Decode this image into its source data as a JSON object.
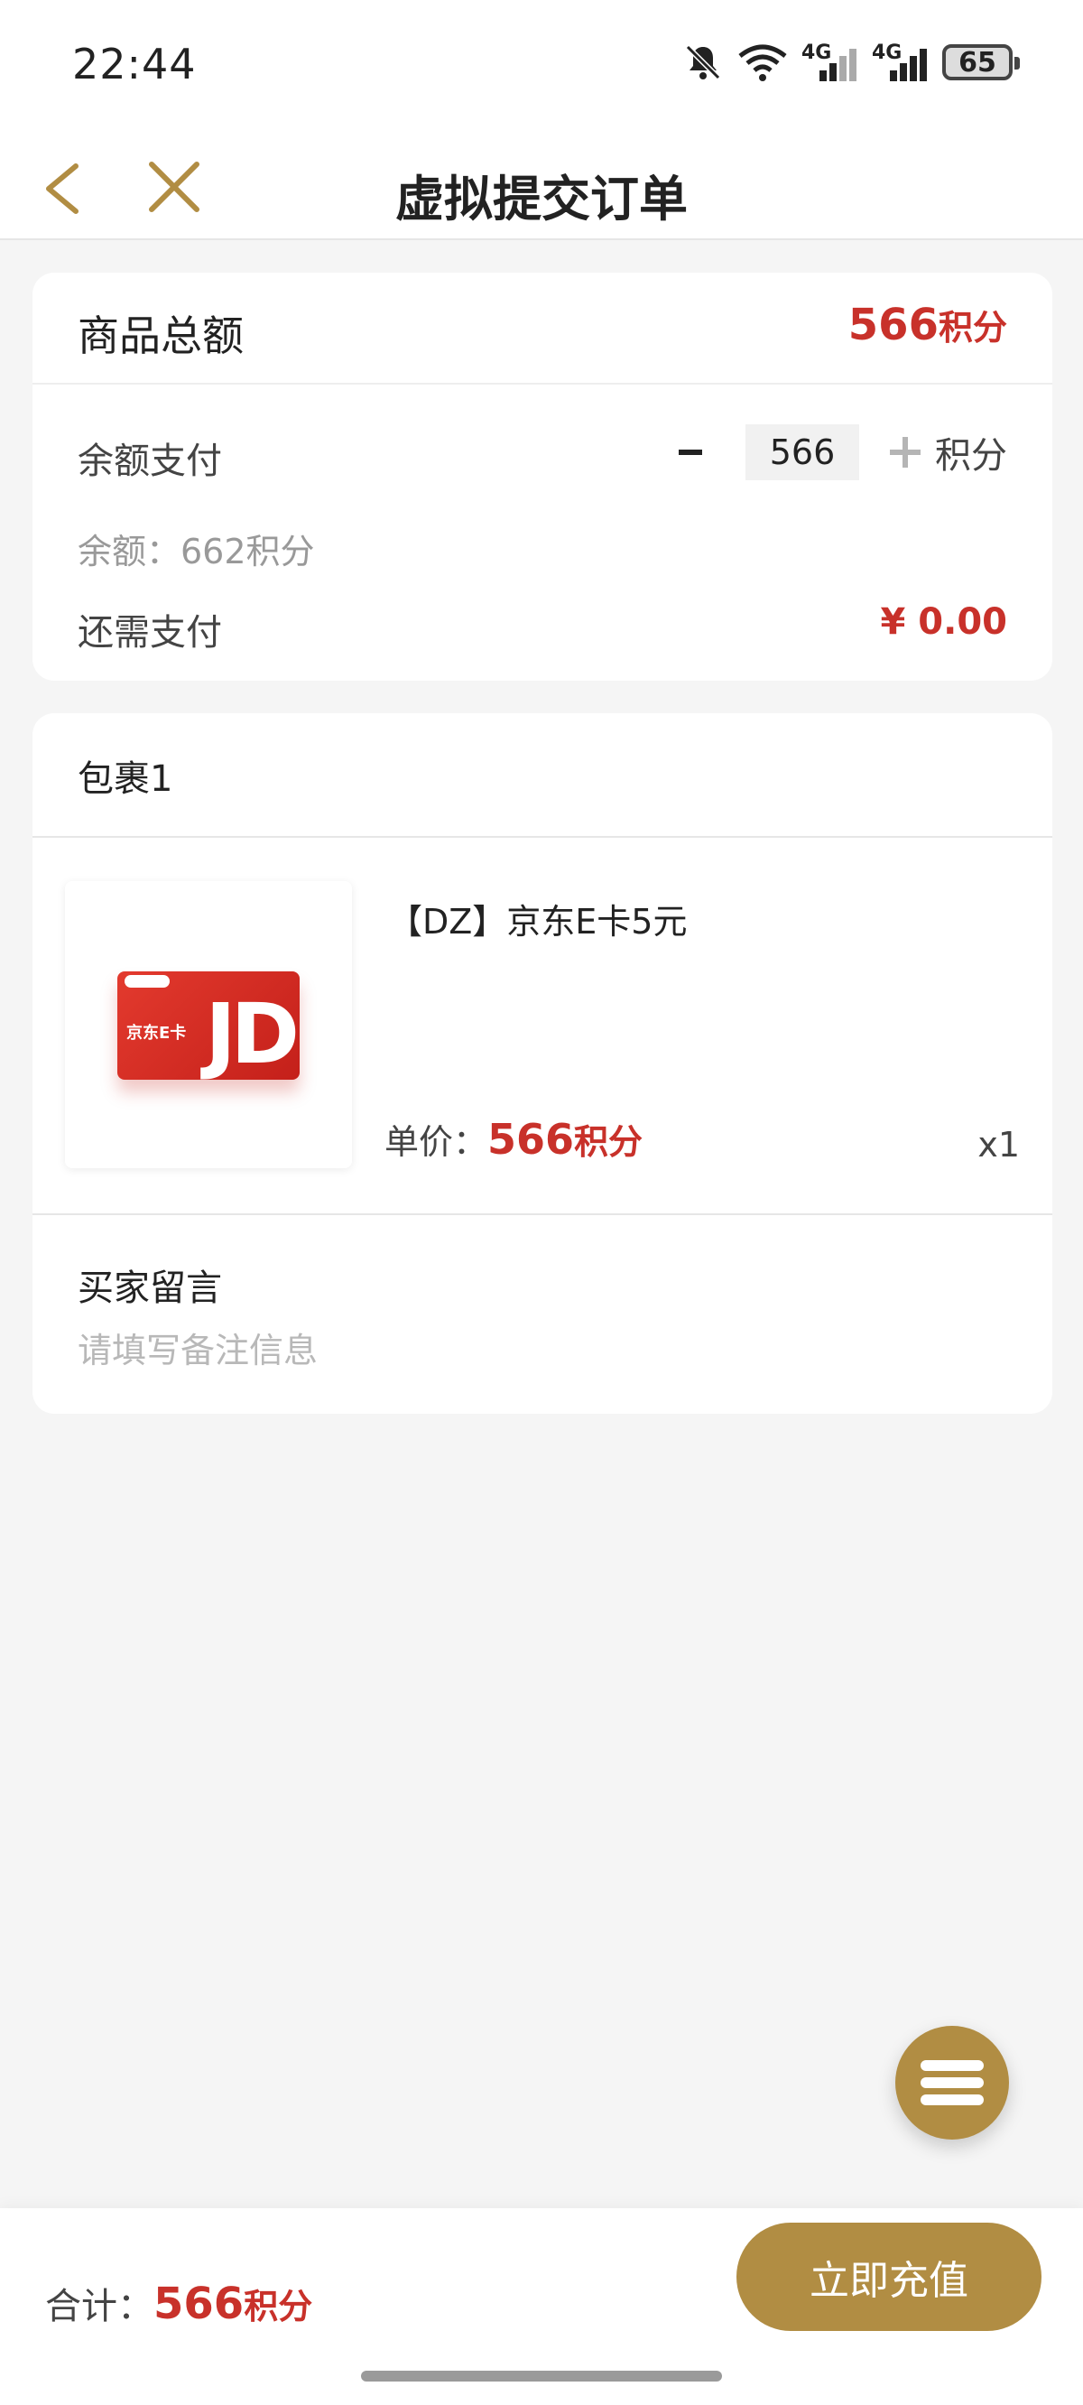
{
  "status": {
    "time": "22:44",
    "signal1_label": "4G",
    "signal2_label": "4G",
    "battery": "65"
  },
  "nav": {
    "title": "虚拟提交订单"
  },
  "summary": {
    "total_label": "商品总额",
    "total_value": "566",
    "points_unit": "积分",
    "balance_pay_label": "余额支付",
    "balance_pay_value": "566",
    "balance_text": "余额：662积分",
    "need_pay_label": "还需支付",
    "need_pay_value": "¥ 0.00"
  },
  "package": {
    "title": "包裹1",
    "item": {
      "name": "【DZ】京东E卡5元",
      "price_label": "单价：",
      "price_value": "566",
      "points_unit": "积分",
      "qty": "x1",
      "image_label": "京东E卡",
      "image_logo": "JD"
    },
    "message_label": "买家留言",
    "message_placeholder": "请填写备注信息"
  },
  "footer": {
    "sum_label": "合计：",
    "sum_value": "566",
    "points_unit": "积分",
    "action_label": "立即充值"
  },
  "colors": {
    "accent": "#b18d43",
    "price": "#c8312a"
  }
}
